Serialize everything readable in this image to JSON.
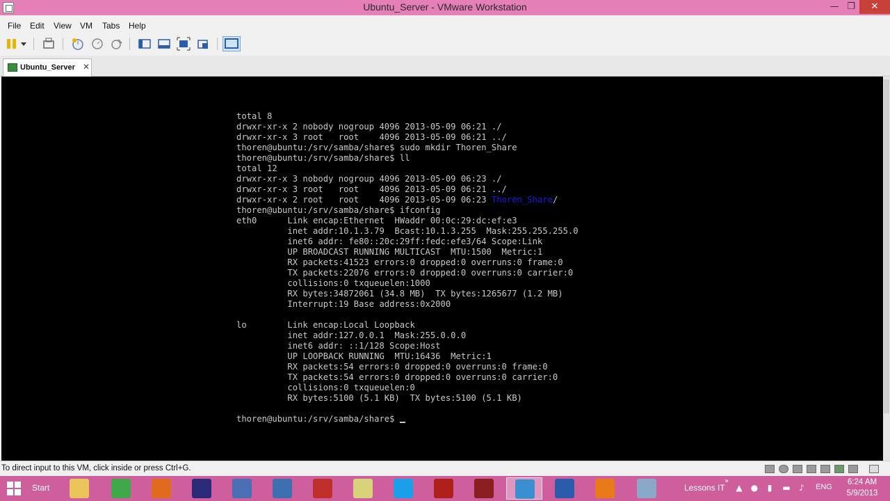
{
  "window": {
    "title": "Ubuntu_Server - VMware Workstation"
  },
  "menu": [
    "File",
    "Edit",
    "View",
    "VM",
    "Tabs",
    "Help"
  ],
  "tab": {
    "label": "Ubuntu_Server"
  },
  "terminal": {
    "lines": [
      "total 8",
      "drwxr-xr-x 2 nobody nogroup 4096 2013-05-09 06:21 ./",
      "drwxr-xr-x 3 root   root    4096 2013-05-09 06:21 ../",
      "thoren@ubuntu:/srv/samba/share$ sudo mkdir Thoren_Share",
      "thoren@ubuntu:/srv/samba/share$ ll",
      "total 12",
      "drwxr-xr-x 3 nobody nogroup 4096 2013-05-09 06:23 ./",
      "drwxr-xr-x 3 root   root    4096 2013-05-09 06:21 ../",
      "drwxr-xr-x 2 root   root    4096 2013-05-09 06:23 ",
      "thoren@ubuntu:/srv/samba/share$ ifconfig",
      "eth0      Link encap:Ethernet  HWaddr 00:0c:29:dc:ef:e3",
      "          inet addr:10.1.3.79  Bcast:10.1.3.255  Mask:255.255.255.0",
      "          inet6 addr: fe80::20c:29ff:fedc:efe3/64 Scope:Link",
      "          UP BROADCAST RUNNING MULTICAST  MTU:1500  Metric:1",
      "          RX packets:41523 errors:0 dropped:0 overruns:0 frame:0",
      "          TX packets:22076 errors:0 dropped:0 overruns:0 carrier:0",
      "          collisions:0 txqueuelen:1000",
      "          RX bytes:34872061 (34.8 MB)  TX bytes:1265677 (1.2 MB)",
      "          Interrupt:19 Base address:0x2000",
      "",
      "lo        Link encap:Local Loopback",
      "          inet addr:127.0.0.1  Mask:255.0.0.0",
      "          inet6 addr: ::1/128 Scope:Host",
      "          UP LOOPBACK RUNNING  MTU:16436  Metric:1",
      "          RX packets:54 errors:0 dropped:0 overruns:0 frame:0",
      "          TX packets:54 errors:0 dropped:0 overruns:0 carrier:0",
      "          collisions:0 txqueuelen:0",
      "          RX bytes:5100 (5.1 KB)  TX bytes:5100 (5.1 KB)",
      "",
      "thoren@ubuntu:/srv/samba/share$ "
    ],
    "highlight_dir": "Thoren_Share",
    "highlight_suffix": "/",
    "highlight_color": "#1a1ad8"
  },
  "status": {
    "message": "To direct input to this VM, click inside or press Ctrl+G."
  },
  "taskbar": {
    "start_label": "Start",
    "lessons_label": "Lessons IT",
    "language": "ENG",
    "time": "6:24 AM",
    "date": "5/9/2013",
    "apps": [
      {
        "name": "file-explorer",
        "color": "#e8c45a"
      },
      {
        "name": "chrome",
        "color": "#3ea84a"
      },
      {
        "name": "firefox",
        "color": "#e06a1d"
      },
      {
        "name": "eclipse",
        "color": "#2b2a78"
      },
      {
        "name": "network-tool",
        "color": "#4a6fb5"
      },
      {
        "name": "network-connect",
        "color": "#3e6fb0"
      },
      {
        "name": "bars-app",
        "color": "#c0302a"
      },
      {
        "name": "folder-app",
        "color": "#d8d27a"
      },
      {
        "name": "skype",
        "color": "#1aa0e8"
      },
      {
        "name": "acrobat",
        "color": "#b0201a"
      },
      {
        "name": "book-app",
        "color": "#8b1e1e"
      },
      {
        "name": "vmware",
        "color": "#3a8fd0"
      },
      {
        "name": "word",
        "color": "#2a5caa"
      },
      {
        "name": "media-player",
        "color": "#e87a1a"
      },
      {
        "name": "slides-app",
        "color": "#8aa8c8"
      }
    ]
  }
}
